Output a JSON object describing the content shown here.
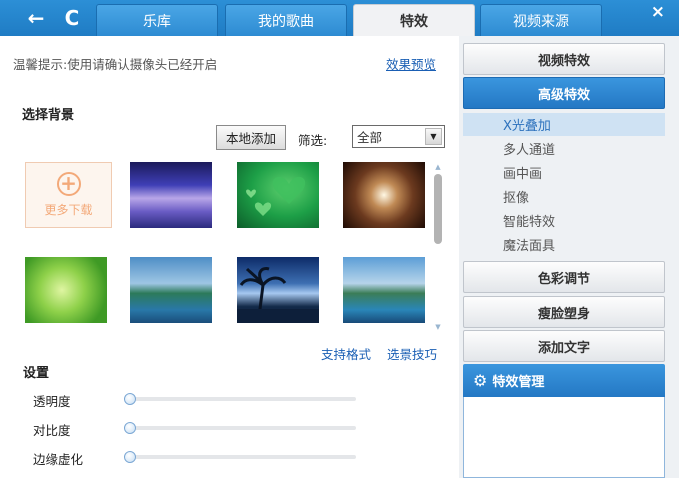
{
  "nav": {
    "back_icon": "←",
    "refresh_icon": "C",
    "close_icon": "×"
  },
  "tabs": [
    {
      "label": "乐库"
    },
    {
      "label": "我的歌曲"
    },
    {
      "label": "特效"
    },
    {
      "label": "视频来源"
    }
  ],
  "active_tab": "特效",
  "hint": "温馨提示:使用请确认摄像头已经开启",
  "preview_link": "效果预览",
  "background": {
    "title": "选择背景",
    "local_add": "本地添加",
    "filter_label": "筛选:",
    "filter_value": "全部",
    "more_label": "更多下载",
    "support_formats": "支持格式",
    "bg_tips": "选景技巧"
  },
  "settings": {
    "title": "设置",
    "sliders": [
      {
        "label": "透明度",
        "value": 0
      },
      {
        "label": "对比度",
        "value": 0
      },
      {
        "label": "边缘虚化",
        "value": 0
      }
    ]
  },
  "right_panel": {
    "video_effects": "视频特效",
    "advanced_effects": "高级特效",
    "sub_items": [
      "X光叠加",
      "多人通道",
      "画中画",
      "抠像",
      "智能特效",
      "魔法面具"
    ],
    "selected_sub": "X光叠加",
    "color_adjust": "色彩调节",
    "face_slim": "瘦脸塑身",
    "add_text": "添加文字",
    "fx_manage": "特效管理"
  },
  "colors": {
    "accent": "#2478c4",
    "link": "#1a5fb4",
    "more_orange": "#f3a979"
  }
}
